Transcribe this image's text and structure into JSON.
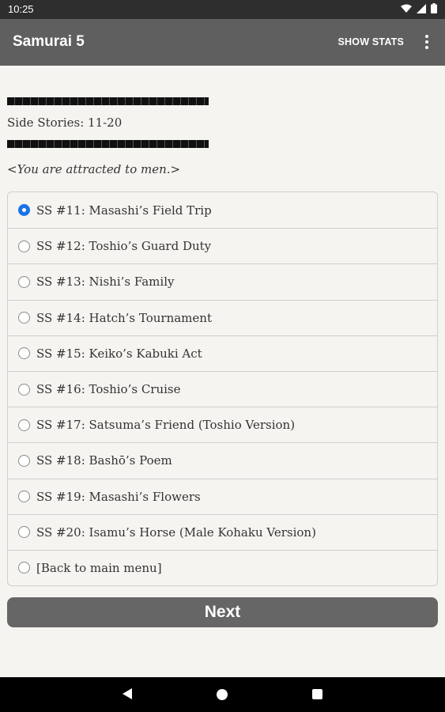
{
  "status_bar": {
    "time": "10:25"
  },
  "app_bar": {
    "title": "Samurai 5",
    "show_stats_label": "SHOW STATS"
  },
  "content": {
    "section_label": "Side Stories: 11-20",
    "flavor_text": "<You are attracted to men.>"
  },
  "options": [
    {
      "label": "SS #11: Masashi’s Field Trip",
      "selected": true
    },
    {
      "label": "SS #12: Toshio’s Guard Duty",
      "selected": false
    },
    {
      "label": "SS #13: Nishi’s Family",
      "selected": false
    },
    {
      "label": "SS #14: Hatch’s Tournament",
      "selected": false
    },
    {
      "label": "SS #15: Keiko’s Kabuki Act",
      "selected": false
    },
    {
      "label": "SS #16: Toshio’s Cruise",
      "selected": false
    },
    {
      "label": "SS #17: Satsuma’s Friend (Toshio Version)",
      "selected": false
    },
    {
      "label": "SS #18: Bashō’s Poem",
      "selected": false
    },
    {
      "label": "SS #19: Masashi’s Flowers",
      "selected": false
    },
    {
      "label": "SS #20: Isamu’s Horse (Male Kohaku Version)",
      "selected": false
    },
    {
      "label": "[Back to main menu]",
      "selected": false
    }
  ],
  "next_button": {
    "label": "Next"
  },
  "colors": {
    "app_bar": "#5f5f5f",
    "background": "#f6f4f0",
    "radio_selected": "#1a73e8",
    "button": "#666666"
  }
}
